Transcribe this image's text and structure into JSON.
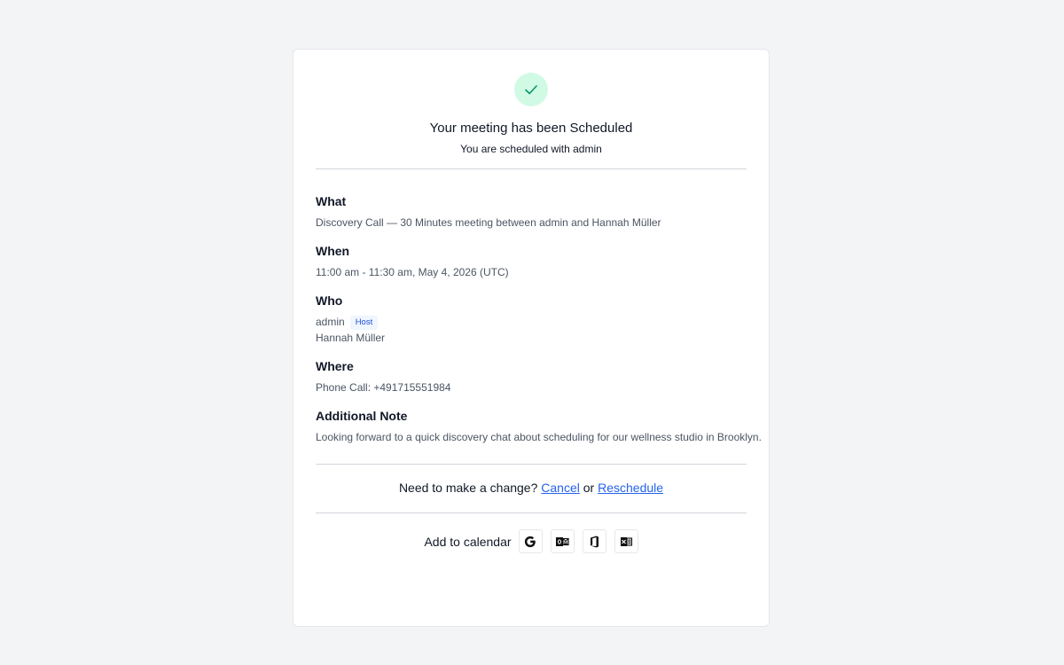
{
  "header": {
    "title": "Your meeting has been Scheduled",
    "subtitle": "You are scheduled with admin"
  },
  "sections": {
    "what": {
      "label": "What",
      "value": "Discovery Call — 30 Minutes meeting between admin and Hannah Müller"
    },
    "when": {
      "label": "When",
      "value": "11:00 am - 11:30 am, May 4, 2026 (UTC)"
    },
    "who": {
      "label": "Who",
      "attendees": [
        {
          "name": "admin",
          "badge": "Host"
        },
        {
          "name": "Hannah Müller"
        }
      ]
    },
    "where": {
      "label": "Where",
      "value": "Phone Call: +491715551984"
    },
    "note": {
      "label": "Additional Note",
      "value": "Looking forward to a quick discovery chat about scheduling for our wellness studio in Brooklyn."
    }
  },
  "change": {
    "prompt": "Need to make a change?",
    "cancel_label": "Cancel",
    "or_text": "or",
    "reschedule_label": "Reschedule"
  },
  "calendar": {
    "label": "Add to calendar",
    "icons": [
      "google-icon",
      "outlook-icon",
      "office365-icon",
      "microsoft-office-icon"
    ]
  },
  "colors": {
    "success_bg": "#d1fae5",
    "success_check": "#059669",
    "link": "#2563eb",
    "badge_text": "#1d4ed8",
    "badge_bg": "#eff6ff"
  }
}
